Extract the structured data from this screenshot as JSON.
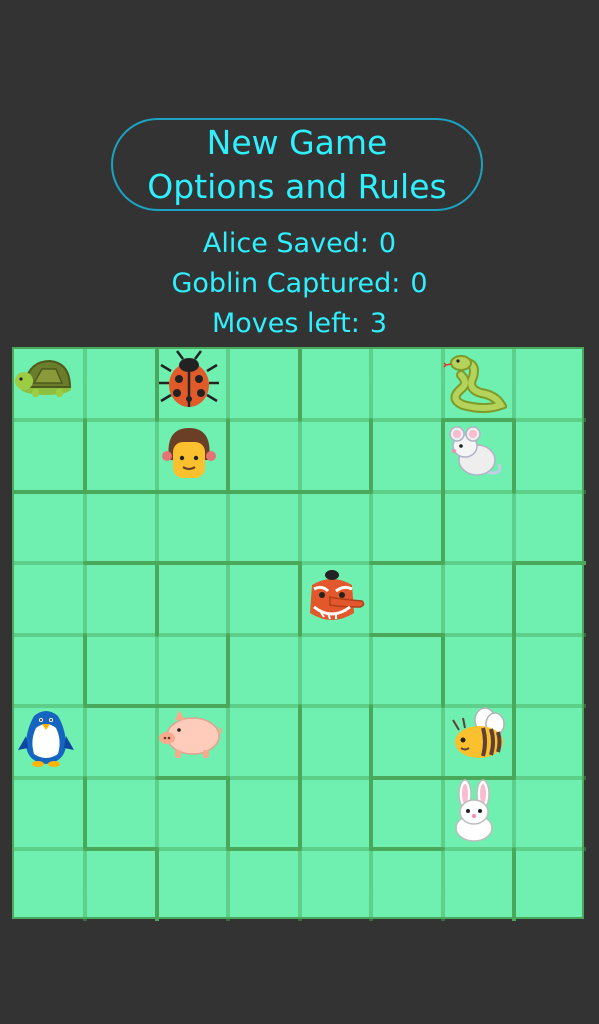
{
  "menu": {
    "line1": "New Game",
    "line2": "Options and Rules"
  },
  "stats": {
    "alice_label": "Alice Saved:",
    "alice_value": "0",
    "goblin_label": "Goblin Captured:",
    "goblin_value": "0",
    "moves_label": "Moves left:",
    "moves_value": "3"
  },
  "colors": {
    "accent": "#2ef0ff",
    "board": "#6ff0b0",
    "wall": "#4aa85a",
    "background": "#333333"
  },
  "pieces": [
    {
      "name": "turtle-piece",
      "icon": "turtle-icon",
      "row": 0,
      "col": 0
    },
    {
      "name": "ladybug-piece",
      "icon": "ladybug-icon",
      "row": 0,
      "col": 2
    },
    {
      "name": "snake-piece",
      "icon": "snake-icon",
      "row": 0,
      "col": 6
    },
    {
      "name": "alice-piece",
      "icon": "girl-icon",
      "row": 1,
      "col": 2
    },
    {
      "name": "mouse-piece",
      "icon": "mouse-icon",
      "row": 1,
      "col": 6
    },
    {
      "name": "goblin-piece",
      "icon": "goblin-icon",
      "row": 3,
      "col": 4
    },
    {
      "name": "penguin-piece",
      "icon": "penguin-icon",
      "row": 5,
      "col": 0
    },
    {
      "name": "pig-piece",
      "icon": "pig-icon",
      "row": 5,
      "col": 2
    },
    {
      "name": "bee-piece",
      "icon": "bee-icon",
      "row": 5,
      "col": 6
    },
    {
      "name": "rabbit-piece",
      "icon": "rabbit-icon",
      "row": 6,
      "col": 6
    }
  ]
}
